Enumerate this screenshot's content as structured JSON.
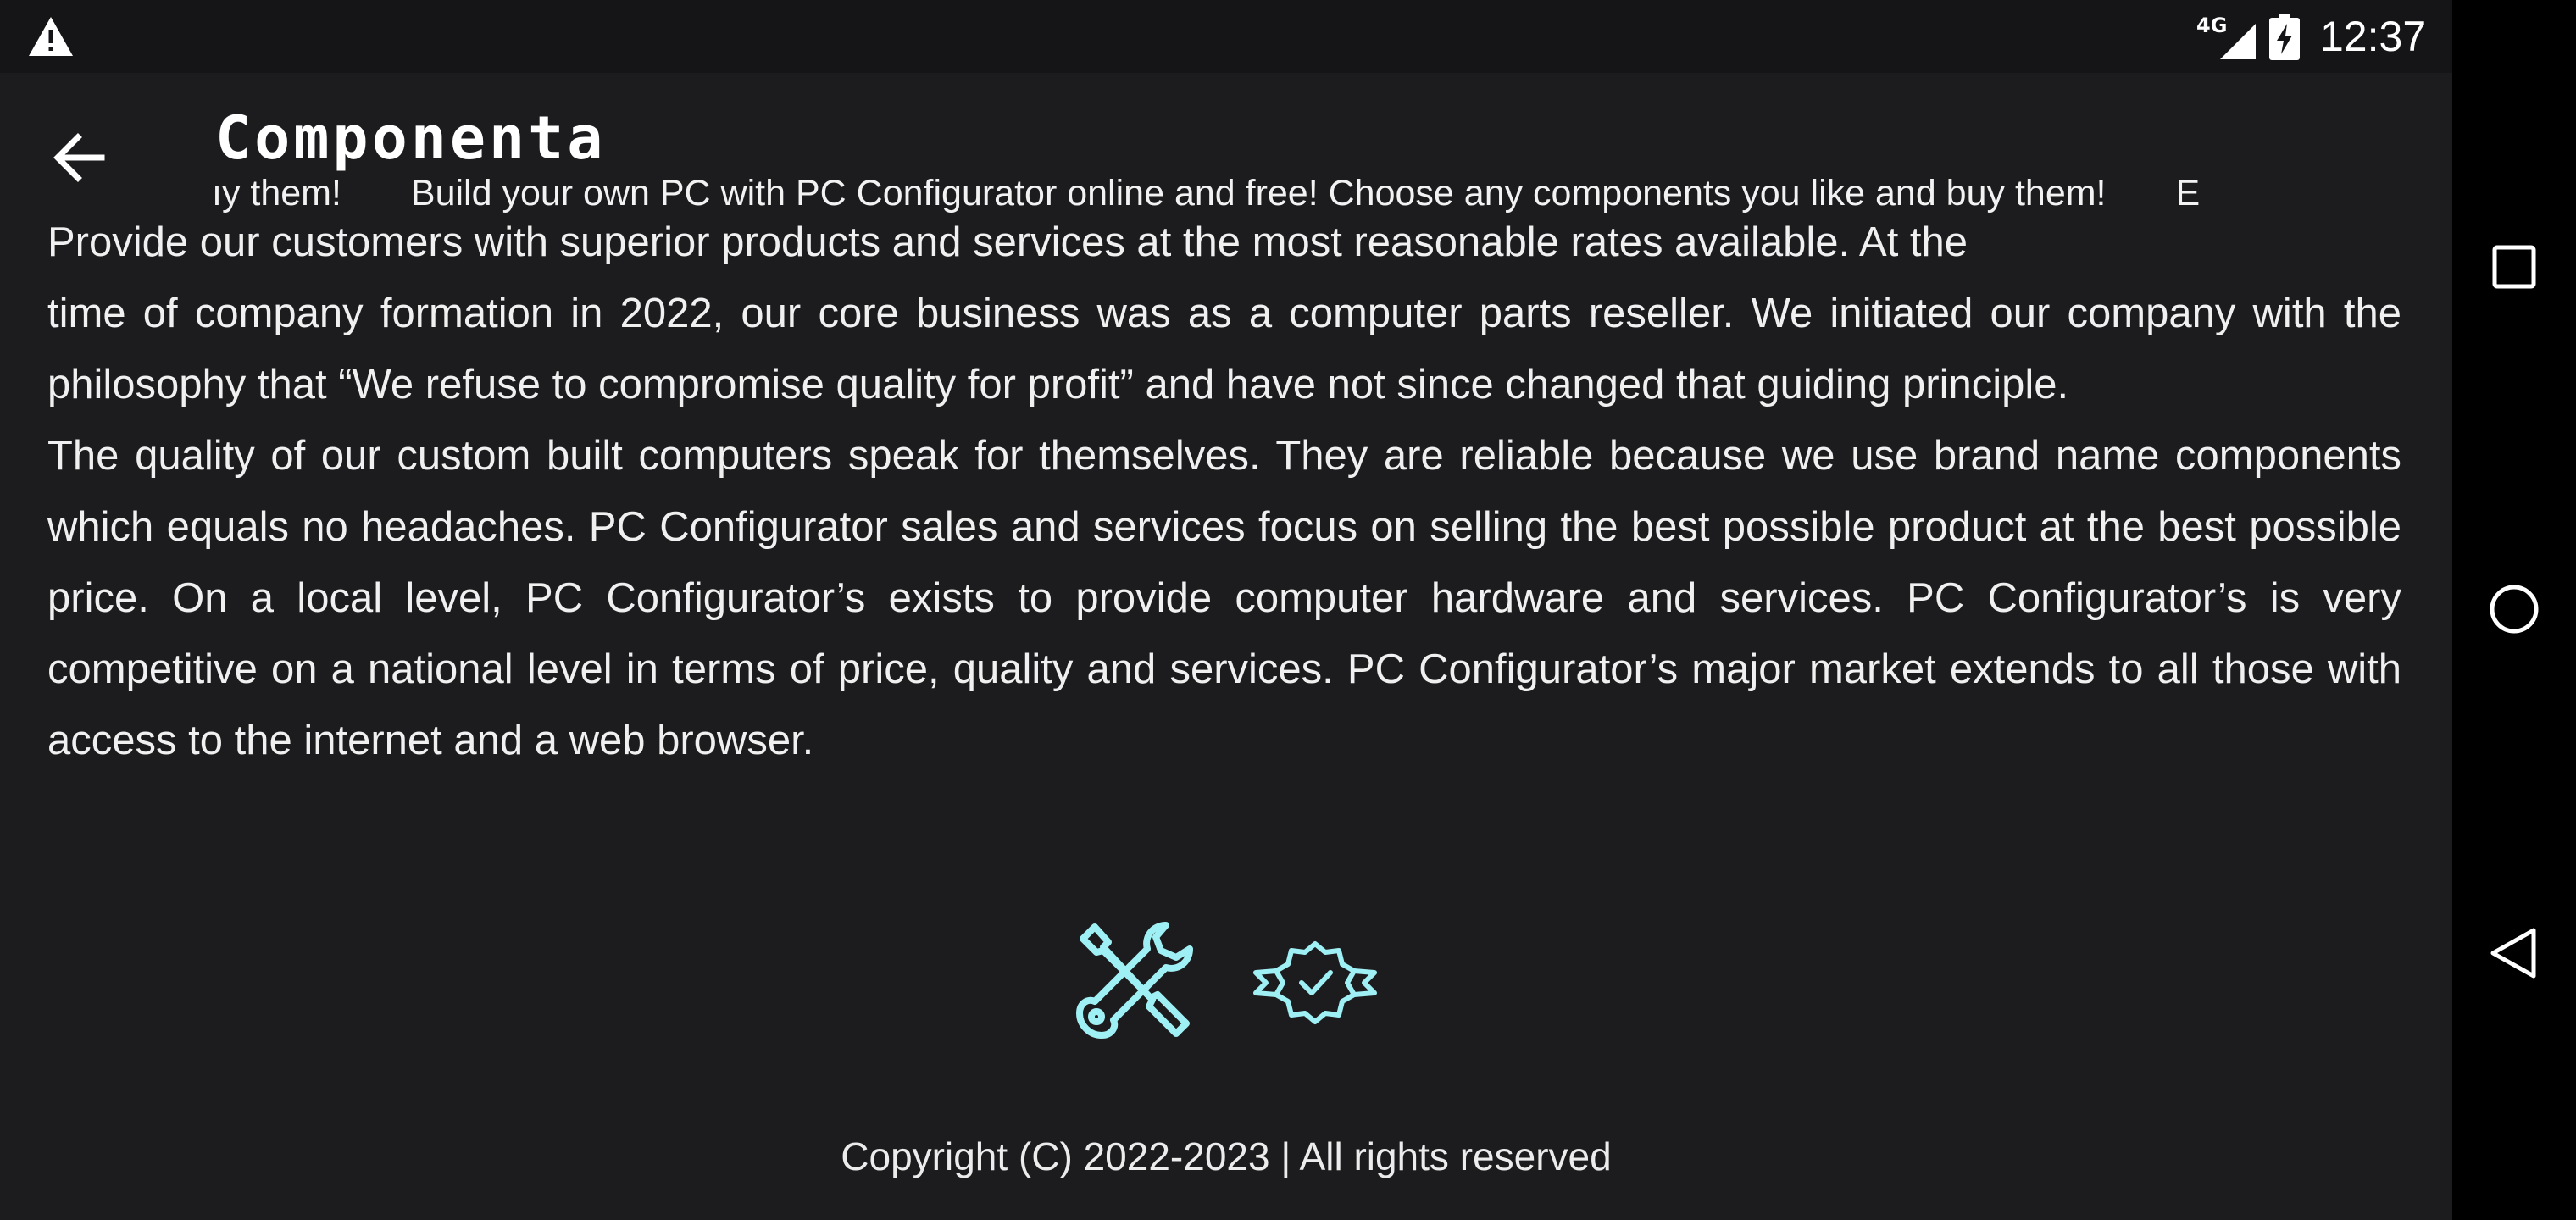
{
  "status_bar": {
    "network": "4G",
    "time": "12:37",
    "icons": [
      "warning-icon",
      "signal-icon",
      "battery-charging-icon"
    ]
  },
  "toolbar": {
    "title": "Componenta",
    "back_icon": "arrow-left-icon",
    "marquee_leading": "ıy them!",
    "marquee_text": "Build your own PC with PC Configurator online and free! Choose any components you like and buy them!",
    "marquee_trailing": "E"
  },
  "about": {
    "partial_line": "Provide our customers with superior products and services at the most reasonable rates available. At the",
    "paragraph1": "time of company formation in 2022, our core business was as a computer parts reseller. We initiated our company with the philosophy that “We refuse to compromise quality for profit” and have not since changed that guiding principle.",
    "paragraph2": "The quality of our custom built computers speak for themselves. They are reliable because we use brand name components which equals no headaches. PC Configurator sales and services focus on selling the best possible product at the best possible price. On a local level, PC Configurator’s exists to provide computer hardware and services. PC Configurator’s is very competitive on a national level in terms of price, quality and services. PC Configurator’s major market extends to all those with access to the internet and a web browser."
  },
  "feature_icons": [
    "tools-icon",
    "verified-badge-icon"
  ],
  "accent_color": "#9ff0f5",
  "footer": {
    "copyright": "Copyright (C) 2022-2023 | All rights reserved"
  },
  "nav_bar": {
    "buttons": [
      "recents-square-icon",
      "home-circle-icon",
      "back-triangle-icon"
    ]
  }
}
